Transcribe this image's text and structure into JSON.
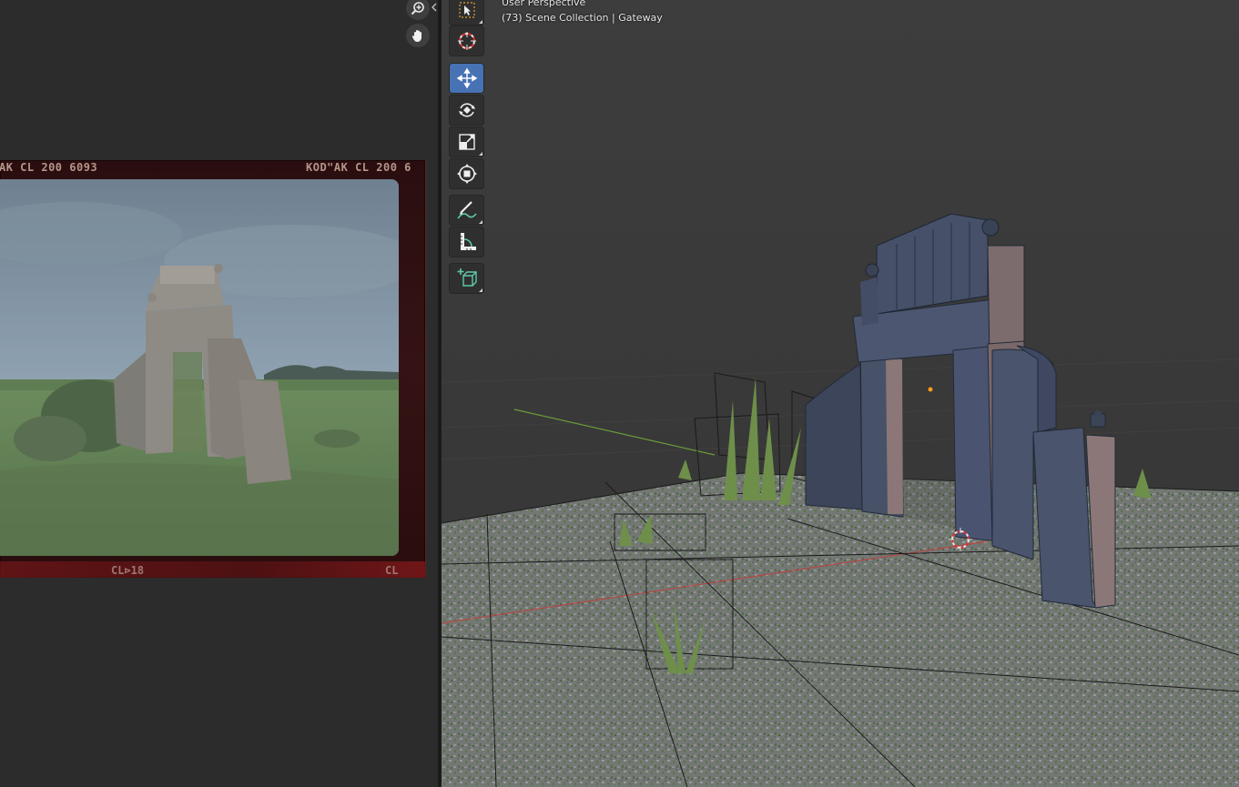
{
  "image_editor": {
    "zoom_icon": "zoom-in-icon",
    "pan_icon": "hand-icon",
    "film_edge": {
      "top_left": "AK CL 200 6093",
      "top_right": "KOD\"AK CL 200 6",
      "bottom_center": "CL⊳18",
      "bottom_right": "CL"
    }
  },
  "viewport": {
    "view_name": "User Perspective",
    "collection_info": "(73) Scene Collection | Gateway"
  },
  "toolbar": {
    "tools": [
      {
        "name": "select-box",
        "icon": "cursor-box-icon",
        "active": false
      },
      {
        "name": "cursor",
        "icon": "crosshair-cursor-icon",
        "active": false
      },
      {
        "name": "move",
        "icon": "move-arrows-icon",
        "active": true
      },
      {
        "name": "rotate",
        "icon": "rotate-icon",
        "active": false
      },
      {
        "name": "scale",
        "icon": "scale-icon",
        "active": false
      },
      {
        "name": "transform",
        "icon": "transform-icon",
        "active": false
      },
      {
        "name": "annotate",
        "icon": "pencil-curve-icon",
        "active": false
      },
      {
        "name": "measure",
        "icon": "ruler-angle-icon",
        "active": false
      },
      {
        "name": "add-cube",
        "icon": "add-cube-icon",
        "active": false
      }
    ]
  },
  "colors": {
    "active_tool": "#4772b3",
    "x_axis": "#c04040",
    "y_axis": "#6a9a3a",
    "origin_dot": "#ff9a1a"
  }
}
